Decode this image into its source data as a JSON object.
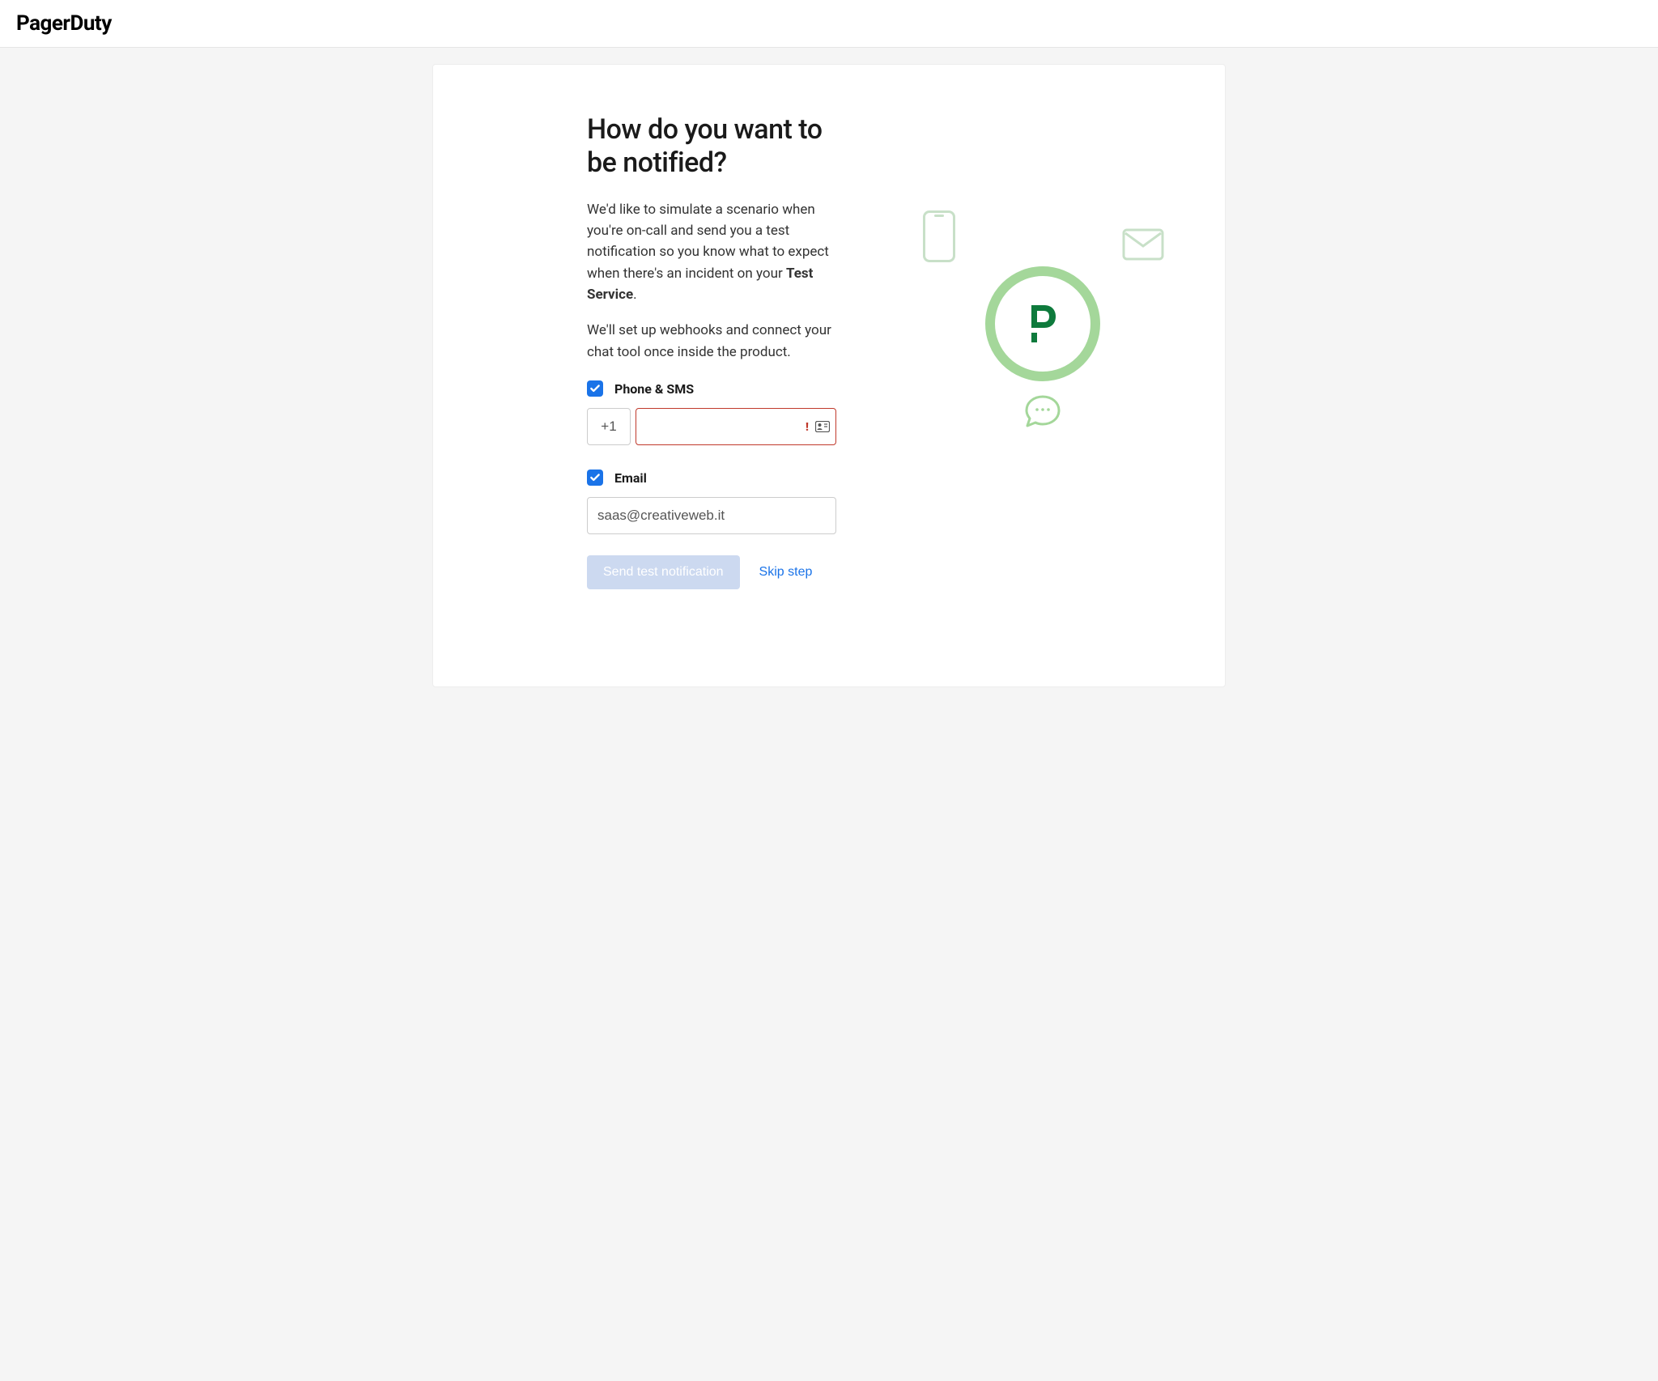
{
  "brand": "PagerDuty",
  "heading": "How do you want to be notified?",
  "desc1_before": "We'd like to simulate a scenario when you're on-call and send you a test notification so you know what to expect when there's an incident on your ",
  "desc1_bold": "Test Service",
  "desc1_after": ".",
  "desc2": "We'll set up webhooks and connect your chat tool once inside the product.",
  "phone_section": {
    "label": "Phone & SMS",
    "checked": true,
    "country_code": "+1",
    "number": ""
  },
  "email_section": {
    "label": "Email",
    "checked": true,
    "value": "saas@creativeweb.it"
  },
  "buttons": {
    "primary": "Send test notification",
    "skip": "Skip step"
  }
}
